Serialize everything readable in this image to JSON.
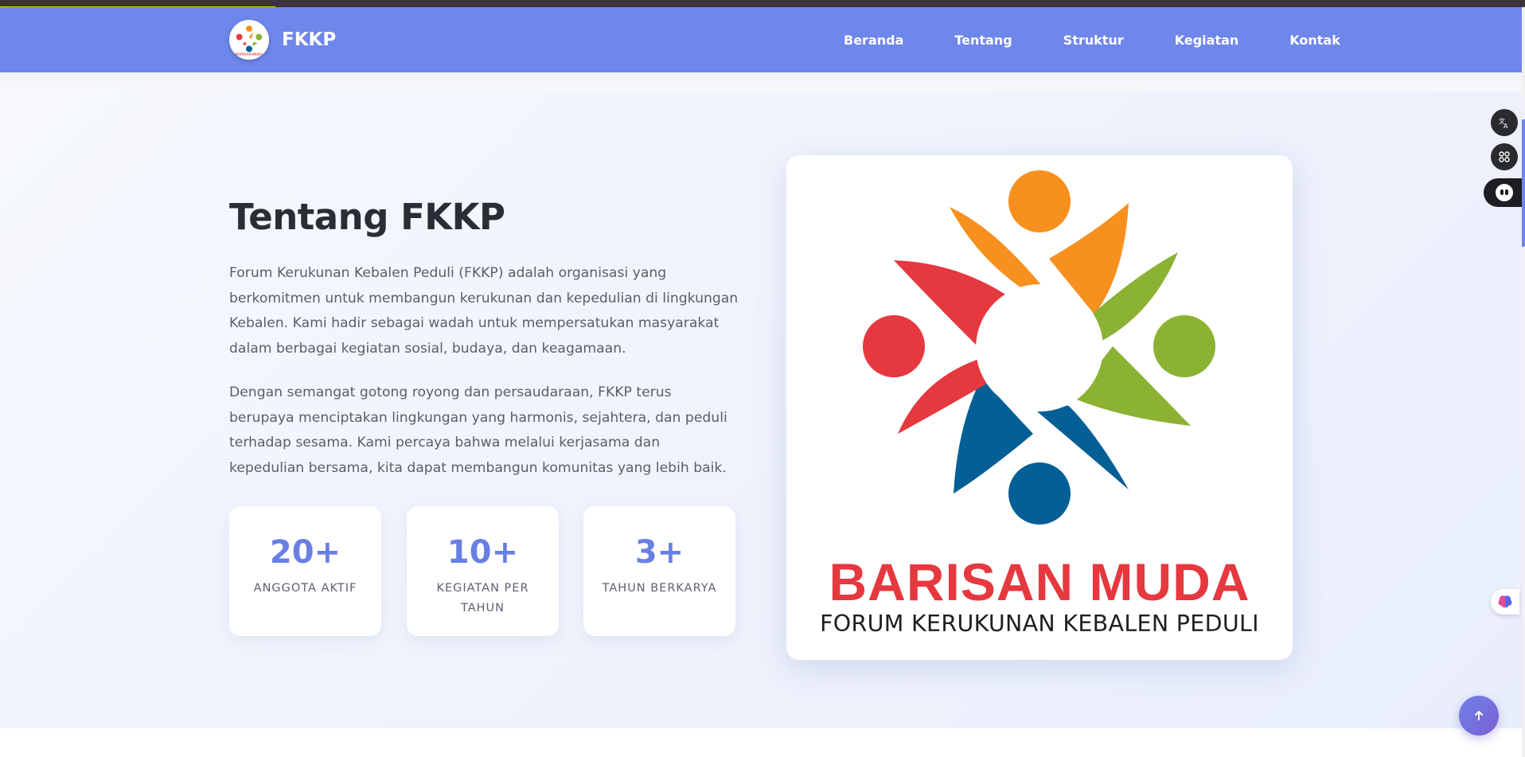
{
  "navbar": {
    "brand": "FKKP",
    "links": [
      "Beranda",
      "Tentang",
      "Struktur",
      "Kegiatan",
      "Kontak"
    ]
  },
  "about": {
    "title": "Tentang FKKP",
    "paragraph1": "Forum Kerukunan Kebalen Peduli (FKKP) adalah organisasi yang berkomitmen untuk membangun kerukunan dan kepedulian di lingkungan Kebalen. Kami hadir sebagai wadah untuk mempersatukan masyarakat dalam berbagai kegiatan sosial, budaya, dan keagamaan.",
    "paragraph2": "Dengan semangat gotong royong dan persaudaraan, FKKP terus berupaya menciptakan lingkungan yang harmonis, sejahtera, dan peduli terhadap sesama. Kami percaya bahwa melalui kerjasama dan kepedulian bersama, kita dapat membangun komunitas yang lebih baik.",
    "stats": [
      {
        "value": "20+",
        "label": "ANGGOTA AKTIF"
      },
      {
        "value": "10+",
        "label": "KEGIATAN PER TAHUN"
      },
      {
        "value": "3+",
        "label": "TAHUN BERKARYA"
      }
    ]
  },
  "logo": {
    "title": "BARISAN MUDA",
    "subtitle": "FORUM KERUKUNAN KEBALEN PEDULI",
    "colors": {
      "orange": "#f7901e",
      "red": "#e6383f",
      "green": "#8bb233",
      "blue": "#035f96"
    }
  },
  "icons": {
    "translate": "translate-icon",
    "apps": "apps-icon",
    "assistant": "assistant-icon",
    "brain": "brain-icon",
    "back_to_top": "arrow-up-icon"
  },
  "colors": {
    "nav_bg": "#6f86ea",
    "accent": "#6a7fe3",
    "progress": "#f5c518"
  }
}
